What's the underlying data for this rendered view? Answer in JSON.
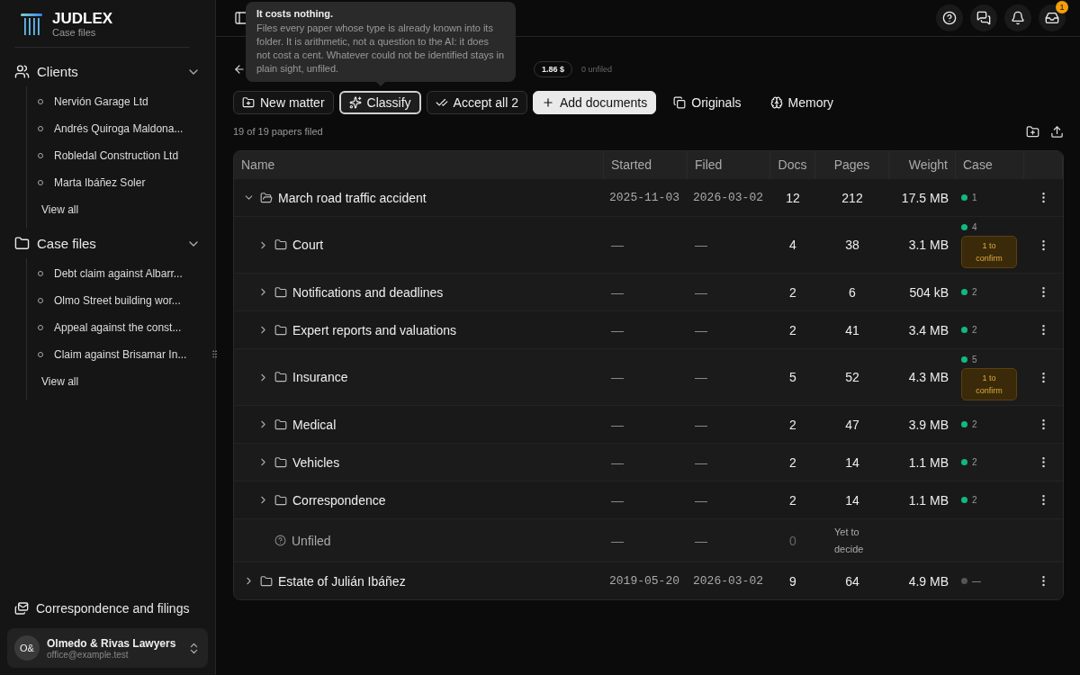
{
  "brand": {
    "name": "JUDLEX",
    "subtitle": "Case files"
  },
  "sidebar": {
    "sections": [
      {
        "kind": "clients",
        "title": "Clients",
        "expanded": true,
        "items": [
          "Nervión Garage Ltd",
          "Andrés Quiroga Maldona...",
          "Robledal Construction Ltd",
          "Marta Ibáñez Soler"
        ],
        "more": "View all"
      },
      {
        "kind": "cases",
        "title": "Case files",
        "expanded": true,
        "items": [
          "Debt claim against Albarr...",
          "Olmo Street building wor...",
          "Appeal against the const...",
          "Claim against Brisamar In..."
        ],
        "more": "View all"
      }
    ],
    "footer_link": "Correspondence and filings",
    "account": {
      "initials": "O&",
      "name": "Olmedo & Rivas Lawyers",
      "email": "office@example.test"
    }
  },
  "topbar": {
    "notification_count": "1"
  },
  "tooltip": {
    "title": "It costs nothing.",
    "body": "Files every paper whose type is already known into its folder. It is arithmetic, not a question to the AI: it does not cost a cent. Whatever could not be identified stays in plain sight, unfiled."
  },
  "summary": {
    "cost": "1.86 $",
    "unfiled": "0 unfiled"
  },
  "actions": [
    {
      "kind": "outline",
      "label": "New matter",
      "active": false
    },
    {
      "kind": "outline",
      "label": "Classify",
      "active": true
    },
    {
      "kind": "outline",
      "label": "Accept all 2",
      "active": false
    },
    {
      "kind": "primary",
      "label": "Add documents",
      "active": false
    },
    {
      "kind": "ghost",
      "label": "Originals",
      "active": false
    },
    {
      "kind": "ghost",
      "label": "Memory",
      "active": false
    }
  ],
  "status": "19 of 19 papers filed",
  "table": {
    "columns": [
      "Name",
      "Started",
      "Filed",
      "Docs",
      "Pages",
      "Weight",
      "Case"
    ],
    "rows": [
      {
        "kind": "matter",
        "name": "March road traffic accident",
        "expanded": true,
        "started": "2025-11-03",
        "filed": "2026-03-02",
        "docs": "12",
        "pages": "212",
        "weight": "17.5 MB",
        "case": "1",
        "color": "#10b981",
        "children": [
          {
            "kind": "folder",
            "name": "Court",
            "expanded": false,
            "started": "—",
            "filed": "—",
            "docs": "4",
            "pages": "38",
            "weight": "3.1 MB",
            "case": "4",
            "color": "#10b981",
            "pending": "1 to confirm"
          },
          {
            "kind": "folder",
            "name": "Notifications and deadlines",
            "expanded": false,
            "started": "—",
            "filed": "—",
            "docs": "2",
            "pages": "6",
            "weight": "504 kB",
            "case": "2",
            "color": "#10b981"
          },
          {
            "kind": "folder",
            "name": "Expert reports and valuations",
            "expanded": false,
            "started": "—",
            "filed": "—",
            "docs": "2",
            "pages": "41",
            "weight": "3.4 MB",
            "case": "2",
            "color": "#10b981"
          },
          {
            "kind": "folder",
            "name": "Insurance",
            "expanded": false,
            "started": "—",
            "filed": "—",
            "docs": "5",
            "pages": "52",
            "weight": "4.3 MB",
            "case": "5",
            "color": "#10b981",
            "pending": "1 to confirm"
          },
          {
            "kind": "folder",
            "name": "Medical",
            "expanded": false,
            "started": "—",
            "filed": "—",
            "docs": "2",
            "pages": "47",
            "weight": "3.9 MB",
            "case": "2",
            "color": "#10b981"
          },
          {
            "kind": "folder",
            "name": "Vehicles",
            "expanded": false,
            "started": "—",
            "filed": "—",
            "docs": "2",
            "pages": "14",
            "weight": "1.1 MB",
            "case": "2",
            "color": "#10b981"
          },
          {
            "kind": "folder",
            "name": "Correspondence",
            "expanded": false,
            "started": "—",
            "filed": "—",
            "docs": "2",
            "pages": "14",
            "weight": "1.1 MB",
            "case": "2",
            "color": "#10b981"
          },
          {
            "kind": "unfiled",
            "name": "Unfiled",
            "started": "—",
            "filed": "—",
            "docs": "0",
            "pages": "Yet to decide"
          }
        ]
      },
      {
        "kind": "matter",
        "name": "Estate of Julián Ibáñez",
        "expanded": false,
        "started": "2019-05-20",
        "filed": "2026-03-02",
        "docs": "9",
        "pages": "64",
        "weight": "4.9 MB",
        "case": "—",
        "color": "#555555"
      }
    ]
  }
}
